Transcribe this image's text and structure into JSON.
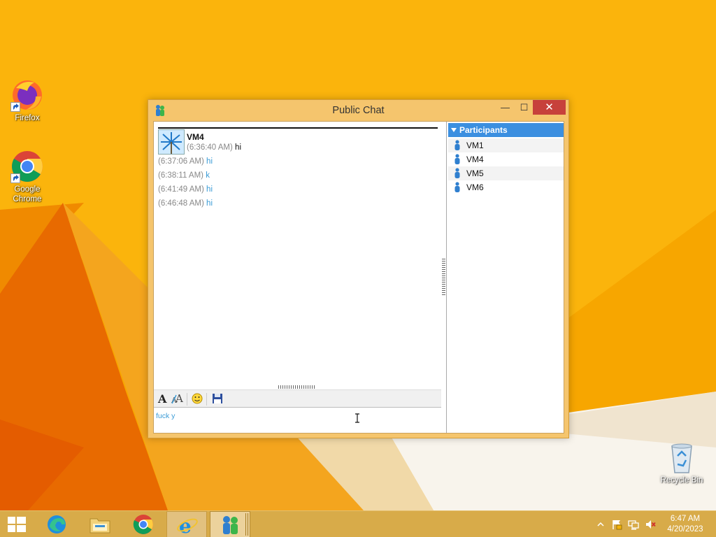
{
  "desktop": {
    "icons": [
      {
        "label": "Firefox"
      },
      {
        "label": "Google Chrome"
      },
      {
        "label": "Recycle Bin"
      }
    ]
  },
  "window": {
    "title": "Public Chat",
    "controls": {
      "minimize": "—",
      "maximize": "☐",
      "close": "✕"
    }
  },
  "chat": {
    "sender": "VM4",
    "messages": [
      {
        "time": "(6:36:40 AM)",
        "text": "hi"
      },
      {
        "time": "(6:37:06 AM)",
        "text": "hi"
      },
      {
        "time": "(6:38:11 AM)",
        "text": "k"
      },
      {
        "time": "(6:41:49 AM)",
        "text": "hi"
      },
      {
        "time": "(6:46:48 AM)",
        "text": "hi"
      }
    ],
    "compose_value": "fuck y"
  },
  "participants": {
    "header": "Participants",
    "items": [
      "VM1",
      "VM4",
      "VM5",
      "VM6"
    ]
  },
  "taskbar": {
    "clock_time": "6:47 AM",
    "clock_date": "4/20/2023"
  },
  "colors": {
    "desktop_bg": "#f6a300",
    "window_frame": "#f5c56d",
    "close_button": "#c7413b",
    "participants_header": "#3b8fe0",
    "message_text": "#3a9bd6",
    "taskbar": "#d8ab49"
  }
}
